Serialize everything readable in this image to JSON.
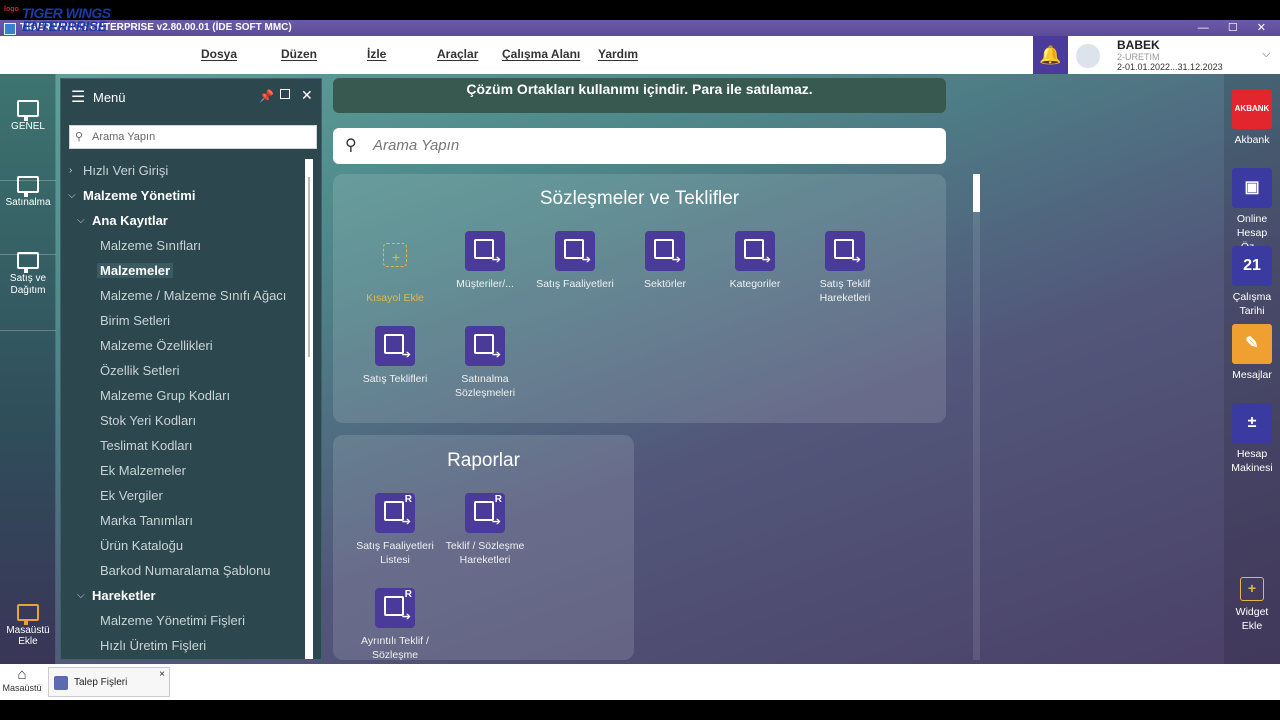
{
  "window": {
    "title": "TIGER WINGS ENTERPRISE v2.80.00.01 (İDE SOFT MMC)"
  },
  "logo": {
    "line1": "TIGER WINGS",
    "line2": "ENTERPRISE",
    "brand": "logo"
  },
  "menubar": {
    "items": [
      "Dosya",
      "Düzen",
      "İzle",
      "Araçlar",
      "Çalışma Alanı",
      "Yardım"
    ]
  },
  "user": {
    "name": "BABEK",
    "line1": "2-URETIM",
    "line2": "2-01.01.2022...31.12.2023"
  },
  "rail": {
    "items": [
      {
        "label": "GENEL",
        "icon": "monitor-icon"
      },
      {
        "label": "Satınalma",
        "icon": "monitor-icon"
      },
      {
        "label": "Satış ve Dağıtım",
        "icon": "monitor-icon"
      }
    ],
    "add_label": "Masaüstü Ekle"
  },
  "menu": {
    "title": "Menü",
    "search_placeholder": "Arama Yapın",
    "tree": {
      "quick": "Hızlı Veri Girişi",
      "section": "Malzeme Yönetimi",
      "group1": "Ana Kayıtlar",
      "group1_items": [
        "Malzeme Sınıfları",
        "Malzemeler",
        "Malzeme / Malzeme Sınıfı Ağacı",
        "Birim Setleri",
        "Malzeme Özellikleri",
        "Özellik Setleri",
        "Malzeme Grup Kodları",
        "Stok Yeri Kodları",
        "Teslimat Kodları",
        "Ek Malzemeler",
        "Ek Vergiler",
        "Marka Tanımları",
        "Ürün Kataloğu",
        "Barkod Numaralama Şablonu"
      ],
      "group2": "Hareketler",
      "group2_items": [
        "Malzeme Yönetimi Fişleri",
        "Hızlı Üretim Fişleri"
      ]
    }
  },
  "main": {
    "banner": "Çözüm Ortakları kullanımı içindir. Para ile satılamaz.",
    "search_placeholder": "Arama Yapın",
    "card1": {
      "title": "Sözleşmeler ve Teklifler",
      "add_label": "Kısayol Ekle",
      "tiles": [
        "Müşteriler/...",
        "Satış Faaliyetleri",
        "Sektörler",
        "Kategoriler",
        "Satış Teklif Hareketleri",
        "Satış Teklifleri",
        "Satınalma Sözleşmeleri"
      ]
    },
    "card2": {
      "title": "Raporlar",
      "tiles": [
        "Satış Faaliyetleri Listesi",
        "Teklif / Sözleşme Hareketleri",
        "Ayrıntılı Teklif / Sözleşme"
      ],
      "badge": "R"
    }
  },
  "widgets": {
    "items": [
      {
        "label": "Akbank",
        "color": "#e3262e",
        "glyph": "AKBANK"
      },
      {
        "label": "Online Hesap Öz...",
        "color": "#3b3aa0",
        "glyph": "▣"
      },
      {
        "label": "Çalışma Tarihi",
        "color": "#3b3aa0",
        "glyph": "21"
      },
      {
        "label": "Mesajlar",
        "color": "#f0a030",
        "glyph": "✎"
      },
      {
        "label": "Hesap Makinesi",
        "color": "#3b3aa0",
        "glyph": "±"
      }
    ],
    "add_label": "Widget Ekle"
  },
  "taskbar": {
    "home_label": "Masaüstü",
    "tab_label": "Talep Fişleri"
  }
}
